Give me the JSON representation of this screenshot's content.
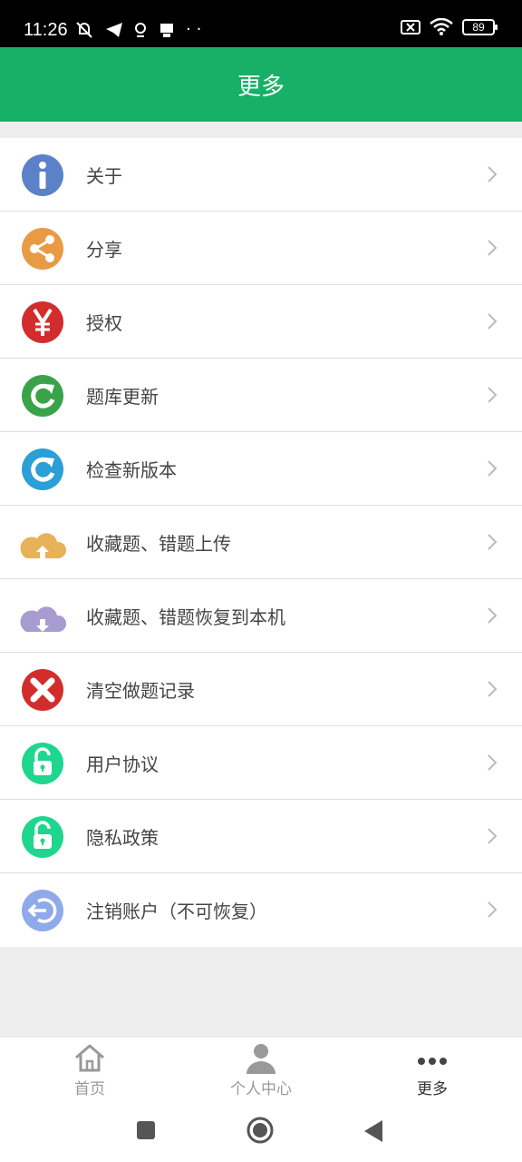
{
  "status_bar": {
    "time": "11:26",
    "battery": "89"
  },
  "app_bar": {
    "title": "更多"
  },
  "menu": [
    {
      "label": "关于",
      "icon": "info-icon",
      "color": "#5b82c8"
    },
    {
      "label": "分享",
      "icon": "share-icon",
      "color": "#e99a45"
    },
    {
      "label": "授权",
      "icon": "yen-icon",
      "color": "#d32c2c"
    },
    {
      "label": "题库更新",
      "icon": "refresh-green-icon",
      "color": "#3aa34a"
    },
    {
      "label": "检查新版本",
      "icon": "refresh-blue-icon",
      "color": "#2b9fd6"
    },
    {
      "label": "收藏题、错题上传",
      "icon": "cloud-upload-icon",
      "color": "#e8b25a"
    },
    {
      "label": "收藏题、错题恢复到本机",
      "icon": "cloud-download-icon",
      "color": "#a69cd0"
    },
    {
      "label": "清空做题记录",
      "icon": "clear-icon",
      "color": "#d32c2c"
    },
    {
      "label": "用户协议",
      "icon": "unlock-icon",
      "color": "#1ed68e"
    },
    {
      "label": "隐私政策",
      "icon": "unlock-icon",
      "color": "#1ed68e"
    },
    {
      "label": "注销账户（不可恢复）",
      "icon": "logout-icon",
      "color": "#8fa9ea"
    }
  ],
  "bottom_nav": [
    {
      "label": "首页",
      "icon": "home-icon"
    },
    {
      "label": "个人中心",
      "icon": "person-icon"
    },
    {
      "label": "更多",
      "icon": "more-icon"
    }
  ]
}
